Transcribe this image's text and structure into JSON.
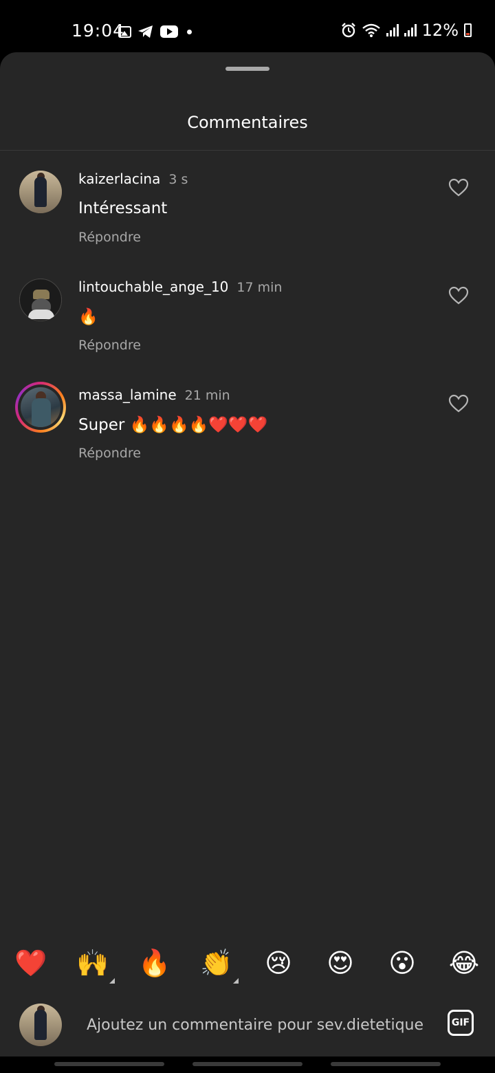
{
  "status_bar": {
    "time": "19:04",
    "battery": "12%",
    "left_icons": [
      "gallery-icon",
      "telegram-icon",
      "youtube-icon",
      "dot-icon"
    ],
    "right_icons": [
      "alarm-icon",
      "wifi-icon",
      "signal-icon",
      "signal-icon",
      "battery-icon"
    ]
  },
  "sheet": {
    "title": "Commentaires"
  },
  "comments": [
    {
      "username": "kaizerlacina",
      "time": "3 s",
      "text": "Intéressant",
      "reply": "Répondre"
    },
    {
      "username": "lintouchable_ange_10",
      "time": "17 min",
      "text": "🔥",
      "reply": "Répondre"
    },
    {
      "username": "massa_lamine",
      "time": "21 min",
      "text": "Super 🔥🔥🔥🔥❤️❤️❤️",
      "reply": "Répondre"
    }
  ],
  "quick_emojis": [
    "❤️",
    "🙌",
    "🔥",
    "👏",
    "😢",
    "😍",
    "😮",
    "😂"
  ],
  "composer": {
    "placeholder": "Ajoutez un commentaire pour sev.dietetique",
    "gif_label": "GIF"
  },
  "colors": {
    "sheet_bg": "#262626",
    "secondary_text": "#a8a8a8",
    "story_ring": [
      "#d62976",
      "#fa7e1e",
      "#962fbf"
    ]
  }
}
